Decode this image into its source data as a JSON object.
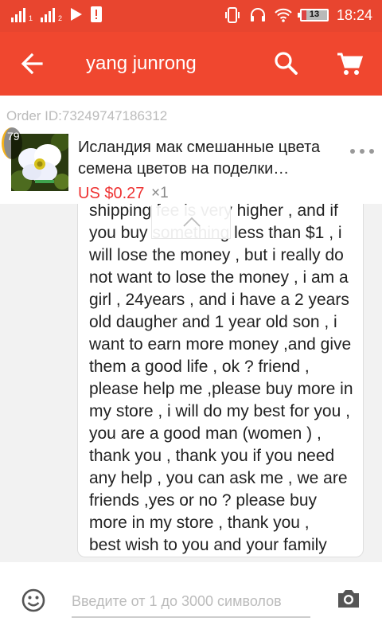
{
  "status_bar": {
    "sim1": "1",
    "sim2": "2",
    "battery": "13",
    "time": "18:24"
  },
  "app_bar": {
    "title": "yang junrong"
  },
  "order": {
    "order_id": "Order ID:73249747186312",
    "badge": "79",
    "product_title": "Исландия мак смешанные цвета семена цветов на поделки…",
    "price": "US $0.27",
    "quantity": "×1"
  },
  "message": {
    "text": "shipping fee is very higher , and if you buy something less than $1 , i will lose the money , but i really do not want to lose the money , i am a girl , 24years , and i have a 2 years old daugher and 1 year old son , i want to earn more money ,and give them a good life , ok ? friend , please help me ,please buy more in my store , i will do my best for you , you are a good man (women ) , thank you , thank you if you need any help , you can ask me , we are friends ,yes or no ? please buy more in my store , thank you ,\nbest wish to you and your family"
  },
  "composer": {
    "placeholder": "Введите от 1 до 3000 символов"
  },
  "colors": {
    "primary": "#f0472f",
    "price": "#e33333"
  }
}
